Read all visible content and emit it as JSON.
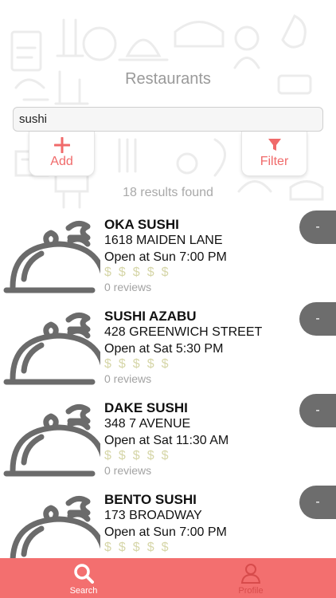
{
  "header": {
    "title": "Restaurants"
  },
  "search": {
    "value": "sushi",
    "placeholder": ""
  },
  "actions": {
    "add_label": "Add",
    "filter_label": "Filter"
  },
  "results_text": "18 results found",
  "restaurants": [
    {
      "name": "OKA SUSHI",
      "address": "1618 MAIDEN LANE",
      "hours": "Open at Sun 7:00 PM",
      "price": "$$$$$",
      "reviews": "0 reviews",
      "action": "-"
    },
    {
      "name": "SUSHI AZABU",
      "address": "428 GREENWICH STREET",
      "hours": "Open at Sat 5:30 PM",
      "price": "$$$$$",
      "reviews": "0 reviews",
      "action": "-"
    },
    {
      "name": "DAKE SUSHI",
      "address": "348 7 AVENUE",
      "hours": "Open at Sat 11:30 AM",
      "price": "$$$$$",
      "reviews": "0 reviews",
      "action": "-"
    },
    {
      "name": "BENTO SUSHI",
      "address": "173 BROADWAY",
      "hours": "Open at Sun 7:00 PM",
      "price": "$$$$$",
      "reviews": "",
      "action": "-"
    }
  ],
  "tabs": [
    {
      "label": "Search",
      "icon": "search-icon",
      "active": true
    },
    {
      "label": "Profile",
      "icon": "person-icon",
      "active": false
    }
  ],
  "colors": {
    "accent": "#f36f6f",
    "minus_button": "#6d6d6d",
    "cloche": "#6b6b6b"
  }
}
